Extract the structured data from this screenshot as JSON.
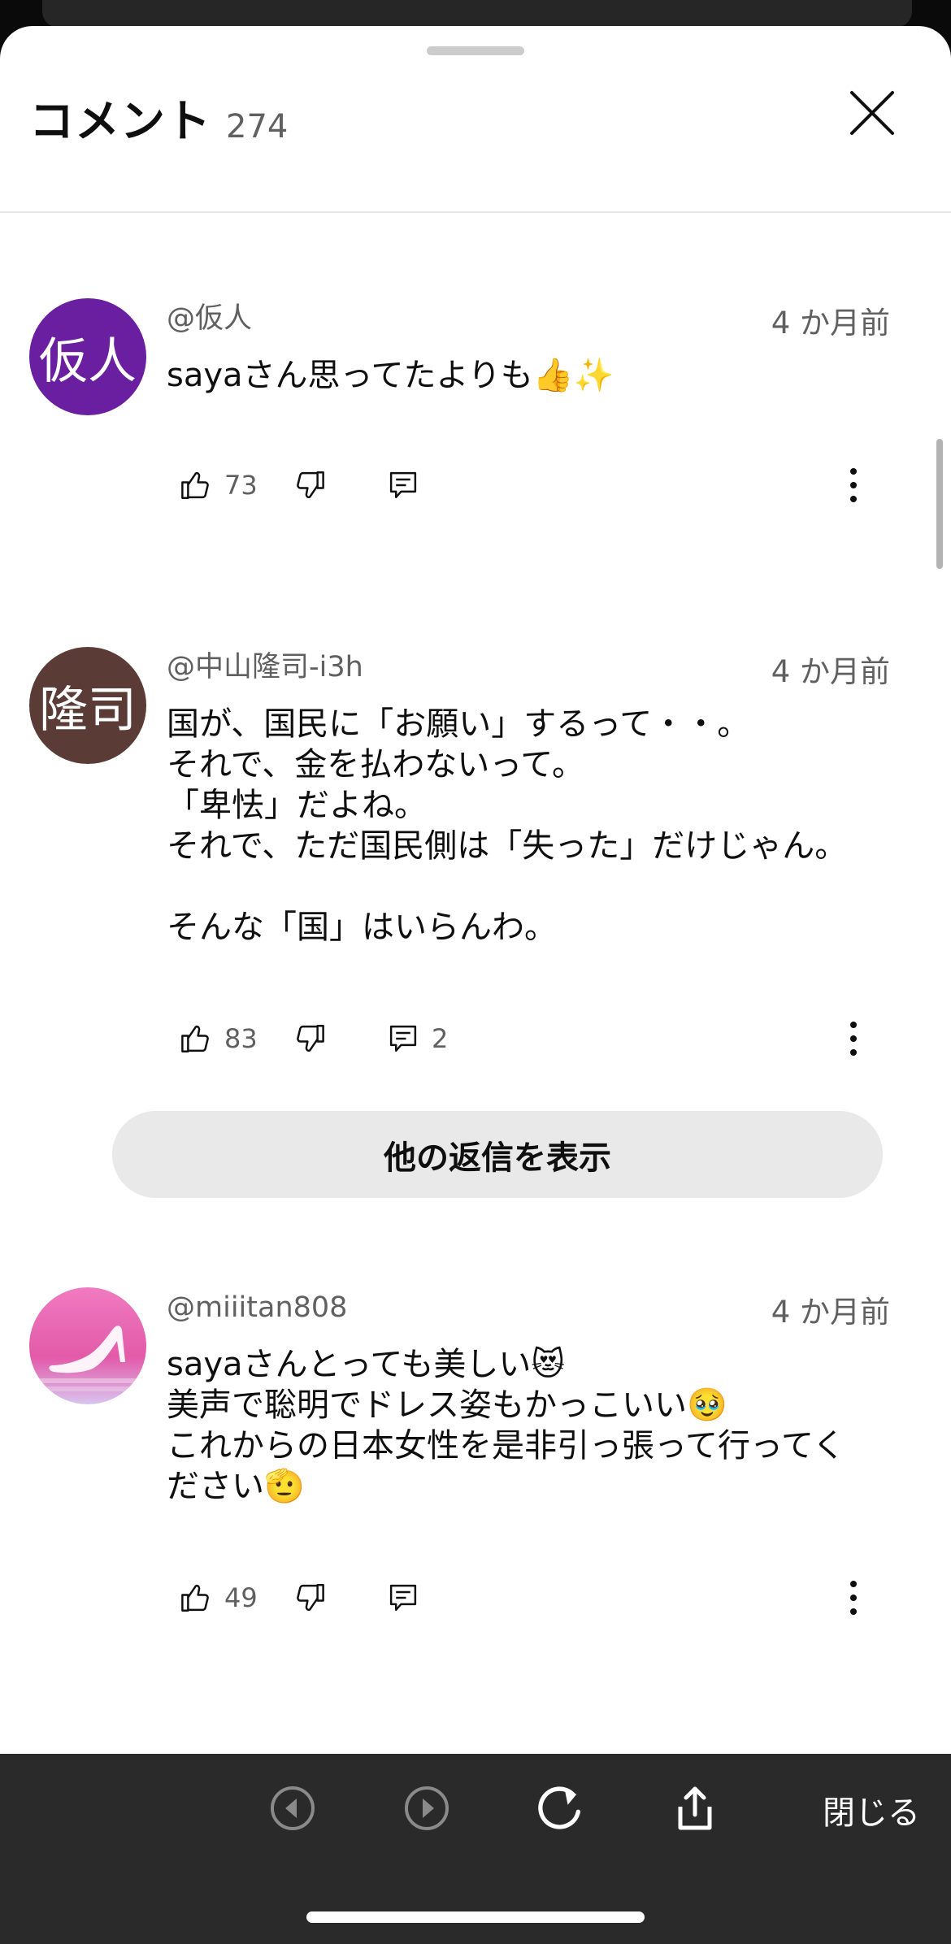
{
  "header": {
    "title": "コメント",
    "count": "274"
  },
  "comments": [
    {
      "avatar_text": "仮人",
      "avatar_color": "#6a1fa0",
      "handle": "@仮人",
      "time": "4 か月前",
      "text": "sayaさん思ってたよりも👍✨",
      "likes": "73",
      "replies": ""
    },
    {
      "avatar_text": "隆司",
      "avatar_color": "#5a3b36",
      "handle": "@中山隆司-i3h",
      "time": "4 か月前",
      "text": "国が、国民に「お願い」するって・・。\nそれで、金を払わないって。\n「卑怯」だよね。\nそれで、ただ国民側は「失った」だけじゃん。\n\nそんな「国」はいらんわ。",
      "likes": "83",
      "replies": "2"
    },
    {
      "avatar_text": "",
      "avatar_color": "#e25aa8",
      "handle": "@miiitan808",
      "time": "4 か月前",
      "text": "sayaさんとっても美しい😻\n美声で聡明でドレス姿もかっこいい🥹\nこれからの日本女性を是非引っ張って行ってく\nださい🫡",
      "likes": "49",
      "replies": ""
    }
  ],
  "show_replies_label": "他の返信を表示",
  "bottom_bar": {
    "close_label": "閉じる"
  }
}
